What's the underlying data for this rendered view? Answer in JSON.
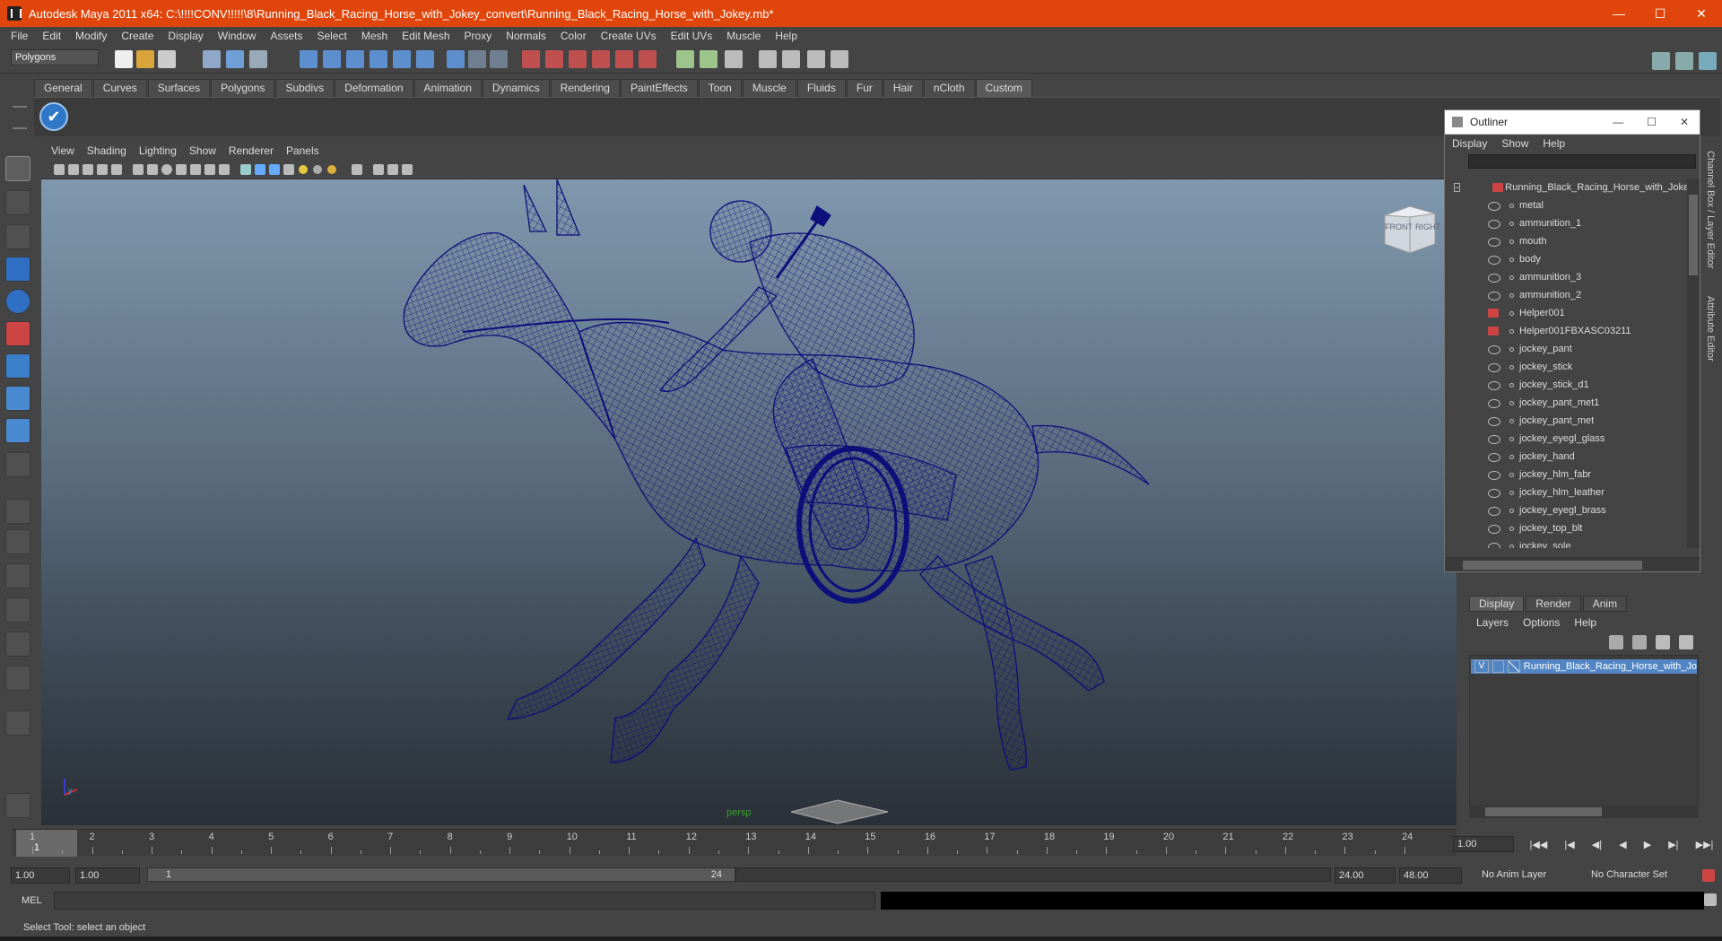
{
  "window": {
    "title": "Autodesk Maya 2011 x64: C:\\!!!!CONV!!!!!\\8\\Running_Black_Racing_Horse_with_Jokey_convert\\Running_Black_Racing_Horse_with_Jokey.mb*",
    "controls": [
      "—",
      "☐",
      "✕"
    ]
  },
  "menubar": [
    "File",
    "Edit",
    "Modify",
    "Create",
    "Display",
    "Window",
    "Assets",
    "Select",
    "Mesh",
    "Edit Mesh",
    "Proxy",
    "Normals",
    "Color",
    "Create UVs",
    "Edit UVs",
    "Muscle",
    "Help"
  ],
  "statusline": {
    "mode": "Polygons"
  },
  "shelf": {
    "tabs": [
      "General",
      "Curves",
      "Surfaces",
      "Polygons",
      "Subdivs",
      "Deformation",
      "Animation",
      "Dynamics",
      "Rendering",
      "PaintEffects",
      "Toon",
      "Muscle",
      "Fluids",
      "Fur",
      "Hair",
      "nCloth",
      "Custom"
    ],
    "active_tab": "Custom"
  },
  "panel": {
    "menu": [
      "View",
      "Shading",
      "Lighting",
      "Show",
      "Renderer",
      "Panels"
    ],
    "camera_label": "persp",
    "viewcube": {
      "front": "FRONT",
      "right": "RIGHT"
    }
  },
  "outliner": {
    "title": "Outliner",
    "menu": [
      "Display",
      "Show",
      "Help"
    ],
    "root": "Running_Black_Racing_Horse_with_Jokey",
    "items": [
      {
        "name": "metal",
        "type": "mesh"
      },
      {
        "name": "ammunition_1",
        "type": "mesh"
      },
      {
        "name": "mouth",
        "type": "mesh"
      },
      {
        "name": "body",
        "type": "mesh"
      },
      {
        "name": "ammunition_3",
        "type": "mesh"
      },
      {
        "name": "ammunition_2",
        "type": "mesh"
      },
      {
        "name": "Helper001",
        "type": "helper"
      },
      {
        "name": "Helper001FBXASC03211",
        "type": "helper"
      },
      {
        "name": "jockey_pant",
        "type": "mesh"
      },
      {
        "name": "jockey_stick",
        "type": "mesh"
      },
      {
        "name": "jockey_stick_d1",
        "type": "mesh"
      },
      {
        "name": "jockey_pant_met1",
        "type": "mesh"
      },
      {
        "name": "jockey_pant_met",
        "type": "mesh"
      },
      {
        "name": "jockey_eyegl_glass",
        "type": "mesh"
      },
      {
        "name": "jockey_hand",
        "type": "mesh"
      },
      {
        "name": "jockey_hlm_fabr",
        "type": "mesh"
      },
      {
        "name": "jockey_hlm_leather",
        "type": "mesh"
      },
      {
        "name": "jockey_eyegl_brass",
        "type": "mesh"
      },
      {
        "name": "jockey_top_blt",
        "type": "mesh"
      },
      {
        "name": "jockey_sole",
        "type": "mesh"
      }
    ]
  },
  "dock": {
    "side_tabs": [
      "Channel Box / Layer Editor",
      "Attribute Editor"
    ],
    "layer_tabs": [
      "Display",
      "Render",
      "Anim"
    ],
    "layer_menu": [
      "Layers",
      "Options",
      "Help"
    ],
    "layer": {
      "visible": "V",
      "name": "Running_Black_Racing_Horse_with_Jo"
    }
  },
  "timeline": {
    "ticks": [
      "1",
      "2",
      "3",
      "4",
      "5",
      "6",
      "7",
      "8",
      "9",
      "10",
      "11",
      "12",
      "13",
      "14",
      "15",
      "16",
      "17",
      "18",
      "19",
      "20",
      "21",
      "22",
      "23",
      "24"
    ],
    "current_marker": "1",
    "current_frame": "1.00",
    "playback": [
      "|◀◀",
      "|◀",
      "◀|",
      "◀",
      "▶",
      "▶|",
      "▶▶|"
    ]
  },
  "range": {
    "start": "1.00",
    "playback_start": "1.00",
    "slider_start": "1",
    "slider_end": "24",
    "playback_end": "24.00",
    "end": "48.00",
    "anim_layer": "No Anim Layer",
    "character_set": "No Character Set"
  },
  "commandline": {
    "label": "MEL"
  },
  "helpline": "Select Tool: select an object",
  "colors": {
    "titlebar": "#e0460c",
    "wireframe": "#0d0f7a",
    "selection": "#5285c3"
  }
}
